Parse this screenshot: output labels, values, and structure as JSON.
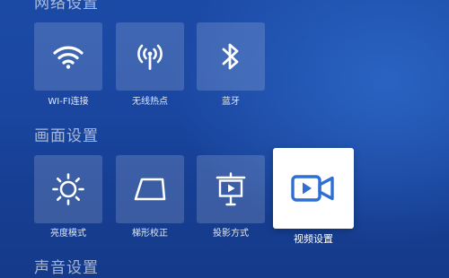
{
  "sections": [
    {
      "title": "网络设置",
      "items": [
        {
          "label": "WI-FI连接",
          "icon": "wifi-icon"
        },
        {
          "label": "无线热点",
          "icon": "hotspot-icon"
        },
        {
          "label": "蓝牙",
          "icon": "bluetooth-icon"
        }
      ]
    },
    {
      "title": "画面设置",
      "items": [
        {
          "label": "亮度模式",
          "icon": "brightness-icon"
        },
        {
          "label": "梯形校正",
          "icon": "keystone-icon"
        },
        {
          "label": "投影方式",
          "icon": "projection-icon"
        },
        {
          "label": "视频设置",
          "icon": "video-camera-icon",
          "selected": true
        }
      ]
    },
    {
      "title": "声音设置",
      "items": []
    }
  ],
  "colors": {
    "background": "#1a46a0",
    "accent_icon": "#2f6ed4",
    "tile": "rgba(255,255,255,0.16)",
    "selected_tile": "#ffffff"
  }
}
